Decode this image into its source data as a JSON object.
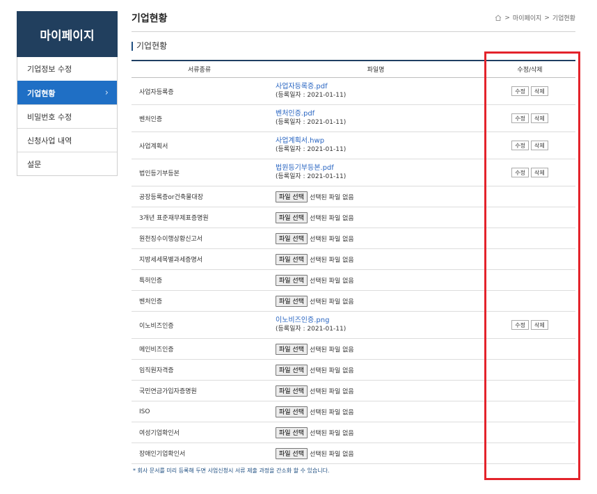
{
  "sidebar": {
    "title": "마이페이지",
    "items": [
      {
        "label": "기업정보 수정"
      },
      {
        "label": "기업현황",
        "active": true
      },
      {
        "label": "비밀번호 수정"
      },
      {
        "label": "신청사업 내역"
      },
      {
        "label": "설문"
      }
    ]
  },
  "header": {
    "title": "기업현황",
    "breadcrumb": [
      "마이페이지",
      "기업현황"
    ],
    "breadcrumb_sep": ">"
  },
  "section": {
    "title": "기업현황"
  },
  "table": {
    "headers": {
      "type": "서류종류",
      "file": "파일명",
      "actions": "수정/삭제"
    },
    "file_button_label": "파일 선택",
    "file_none_text": "선택된 파일 없음",
    "edit_label": "수정",
    "delete_label": "삭제",
    "rows": [
      {
        "type": "사업자등록증",
        "file": "사업자등록증.pdf",
        "date": "(등록일자 : 2021-01-11)"
      },
      {
        "type": "벤처인증",
        "file": "벤처인증.pdf",
        "date": "(등록일자 : 2021-01-11)"
      },
      {
        "type": "사업계획서",
        "file": "사업계획서.hwp",
        "date": "(등록일자 : 2021-01-11)"
      },
      {
        "type": "법인등기부등본",
        "file": "법원등기부등본.pdf",
        "date": "(등록일자 : 2021-01-11)"
      },
      {
        "type": "공장등록증or건축물대장"
      },
      {
        "type": "3개년 표준재무제표증명원"
      },
      {
        "type": "원천징수이행상황신고서"
      },
      {
        "type": "지방세세목별과세증명서"
      },
      {
        "type": "특허인증"
      },
      {
        "type": "벤처인증"
      },
      {
        "type": "이노비즈인증",
        "file": "이노비즈인증.png",
        "date": "(등록일자 : 2021-01-11)"
      },
      {
        "type": "메인비즈인증"
      },
      {
        "type": "임직원자격증"
      },
      {
        "type": "국민연금가입자증명원"
      },
      {
        "type": "ISO"
      },
      {
        "type": "여성기업확인서"
      },
      {
        "type": "장애인기업확인서"
      }
    ]
  },
  "footnote": "* 회사 문서를 미리 등록해 두면 사업신청시 서류 제출 과정을 간소화 할 수 있습니다.",
  "colors": {
    "sidebar_head": "#213f5e",
    "active": "#1f6fc5",
    "link": "#2a66c2",
    "highlight": "#e3232b"
  }
}
